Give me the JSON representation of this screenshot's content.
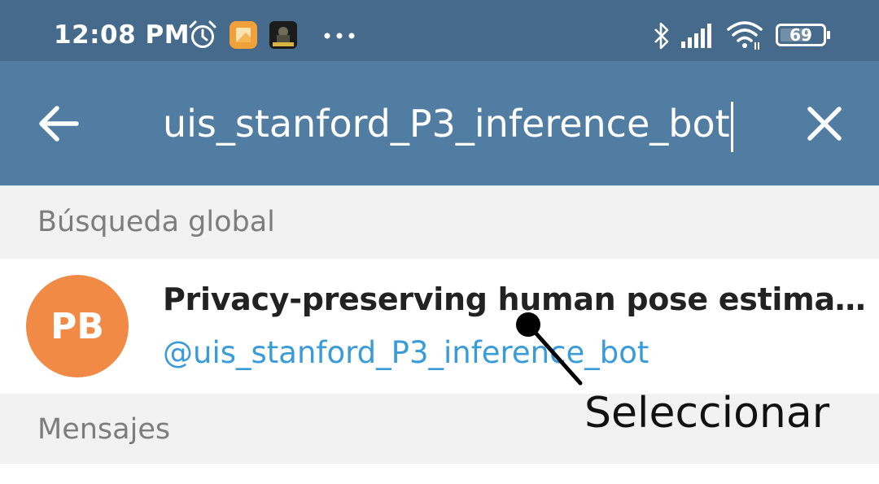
{
  "status_bar": {
    "time": "12:08 PM",
    "battery_level": "69",
    "icons": [
      "alarm-icon",
      "gallery-app-icon",
      "call-of-duty-app-icon",
      "more-dots-icon",
      "bluetooth-icon",
      "signal-icon",
      "wifi-icon",
      "battery-icon"
    ]
  },
  "app_bar": {
    "search_value": "uis_stanford_P3_inference_bot",
    "back_icon": "arrow-left-icon",
    "clear_icon": "close-icon"
  },
  "sections": {
    "global_search_label": "Búsqueda global",
    "messages_label": "Mensajes"
  },
  "result": {
    "avatar_initials": "PB",
    "title": "Privacy-preserving human pose estima…",
    "username": "@uis_stanford_P3_inference_bot"
  },
  "annotation": {
    "label": "Seleccionar"
  },
  "colors": {
    "status_bar": "#456a8b",
    "app_bar": "#517da2",
    "avatar": "#f08a45",
    "username_link": "#3a9bd9",
    "section_bg": "#f2f2f2"
  }
}
